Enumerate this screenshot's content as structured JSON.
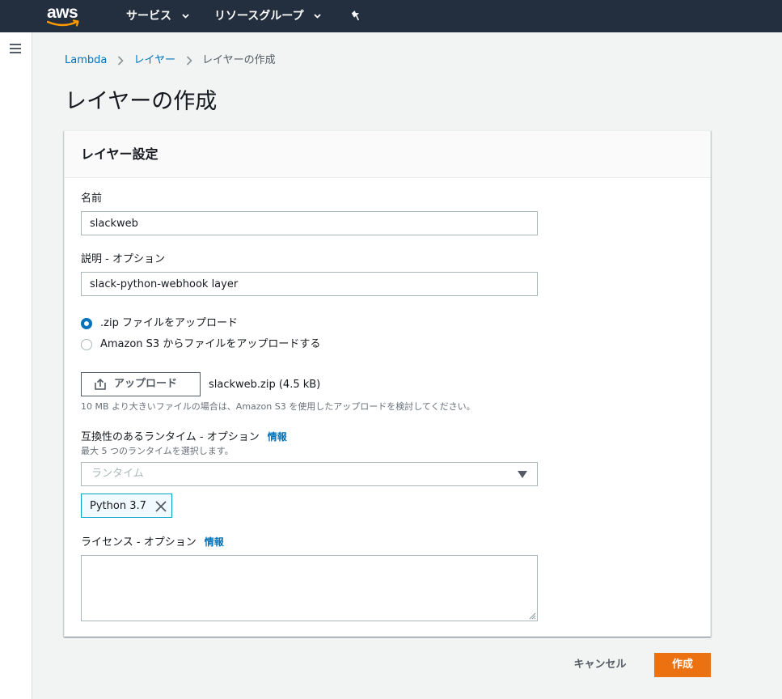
{
  "brand": {
    "logo_text": "aws"
  },
  "topnav": {
    "services_label": "サービス",
    "resource_groups_label": "リソースグループ",
    "pin_icon": "pin-icon"
  },
  "sidebar": {
    "menu_icon": "hamburger-menu-icon"
  },
  "breadcrumb": [
    {
      "label": "Lambda"
    },
    {
      "label": "レイヤー"
    },
    {
      "label": "レイヤーの作成"
    }
  ],
  "page": {
    "title": "レイヤーの作成"
  },
  "form": {
    "section_title": "レイヤー設定",
    "name": {
      "label": "名前",
      "value": "slackweb"
    },
    "description": {
      "label": "説明 - オプション",
      "value": "slack-python-webhook layer"
    },
    "upload_options": [
      {
        "label": ".zip ファイルをアップロード",
        "checked": true
      },
      {
        "label": "Amazon S3 からファイルをアップロードする",
        "checked": false
      }
    ],
    "upload": {
      "button_label": "アップロード",
      "file_name": "slackweb.zip (4.5 kB)",
      "hint": "10 MB より大きいファイルの場合は、Amazon S3 を使用したアップロードを検討してください。"
    },
    "runtimes": {
      "label": "互換性のあるランタイム - オプション",
      "info": "情報",
      "hint": "最大 5 つのランタイムを選択します。",
      "placeholder": "ランタイム",
      "selected": [
        "Python 3.7"
      ]
    },
    "license": {
      "label": "ライセンス - オプション",
      "info": "情報",
      "value": ""
    }
  },
  "actions": {
    "cancel_label": "キャンセル",
    "create_label": "作成"
  },
  "colors": {
    "nav_bg": "#232f3e",
    "link": "#0073bb",
    "primary_button": "#ec7211",
    "token_border": "#00a1c9"
  }
}
